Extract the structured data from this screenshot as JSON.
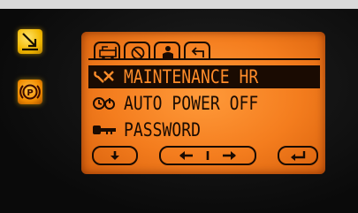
{
  "colors": {
    "lcd_background": "#f47d1e",
    "lcd_ink": "#1a0b02",
    "selected_text": "#ff8c2a",
    "side_button_amber": "#f3b800"
  },
  "side_buttons": [
    {
      "icon": "tilt-arrow-icon"
    },
    {
      "icon": "parking-brake-icon"
    }
  ],
  "tabs": [
    {
      "icon": "truck-icon",
      "active": false
    },
    {
      "icon": "settings-dial-icon",
      "active": false
    },
    {
      "icon": "operator-icon",
      "active": true
    },
    {
      "icon": "return-icon",
      "active": false
    }
  ],
  "menu": {
    "items": [
      {
        "label": "MAINTENANCE HR",
        "icon": "wrench-icon",
        "selected": true
      },
      {
        "label": "AUTO POWER OFF",
        "icon": "power-timer-icon",
        "selected": false
      },
      {
        "label": "PASSWORD",
        "icon": "key-icon",
        "selected": false
      }
    ]
  },
  "soft_buttons": [
    {
      "icon": "arrow-down-icon"
    },
    {
      "icon": "left-right-arrows-icon"
    },
    {
      "icon": "enter-icon"
    }
  ]
}
